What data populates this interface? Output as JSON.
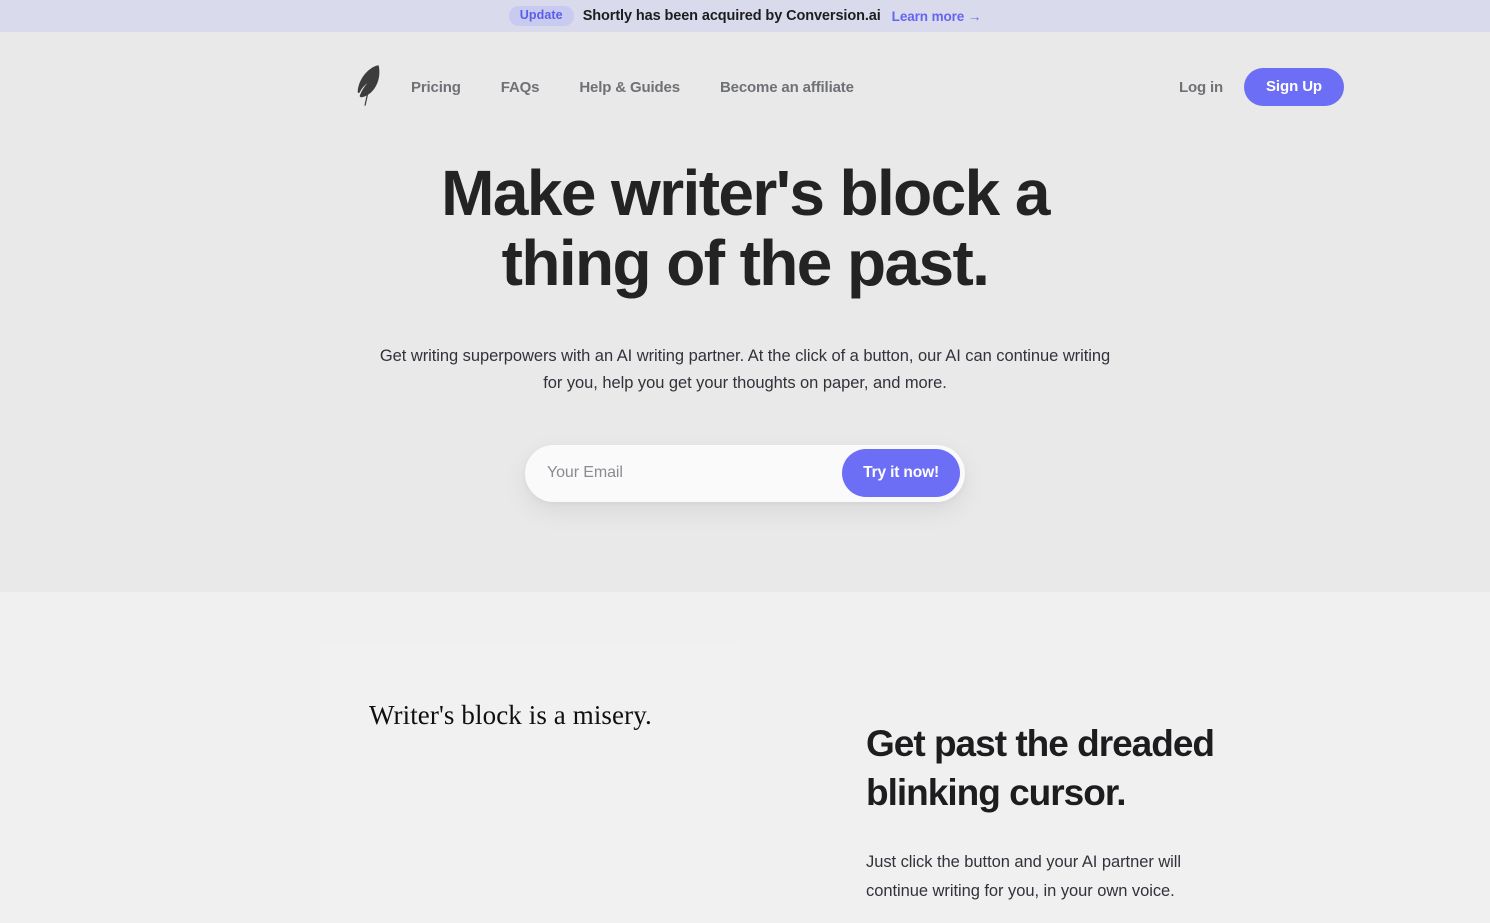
{
  "announcement": {
    "badge": "Update",
    "message": "Shortly has been acquired by Conversion.ai",
    "link_label": "Learn more →",
    "bar_color": "#dadaed",
    "badge_color": "#c9caf0",
    "accent_color": "#6366f1"
  },
  "nav": {
    "logo_icon": "feather-quill-icon",
    "links": [
      {
        "label": "Pricing"
      },
      {
        "label": "FAQs"
      },
      {
        "label": "Help & Guides"
      },
      {
        "label": "Become an affiliate"
      }
    ],
    "login_label": "Log in",
    "signup_label": "Sign Up",
    "signup_color": "#6c6ef5",
    "link_color": "#6f7176"
  },
  "hero": {
    "title_line_1": "Make writer's block a",
    "title_line_2": "thing of the past.",
    "subtitle": "Get writing superpowers with an AI writing partner. At the click of a button, our AI can continue writing for you, help you get your thoughts on paper, and more.",
    "background_color": "#e9e9e9",
    "email_placeholder": "Your Email",
    "email_value": "",
    "cta_label": "Try it now!",
    "cta_color": "#6c6ef5"
  },
  "feature": {
    "editor_quote": "Writer's block is a misery.",
    "title_line_1": "Get past the dreaded",
    "title_line_2": "blinking cursor.",
    "body": "Just click the button and your AI partner will continue writing for you, in your own voice.",
    "background_color": "#f0f0f0",
    "card_color": "#f1f1f1"
  }
}
